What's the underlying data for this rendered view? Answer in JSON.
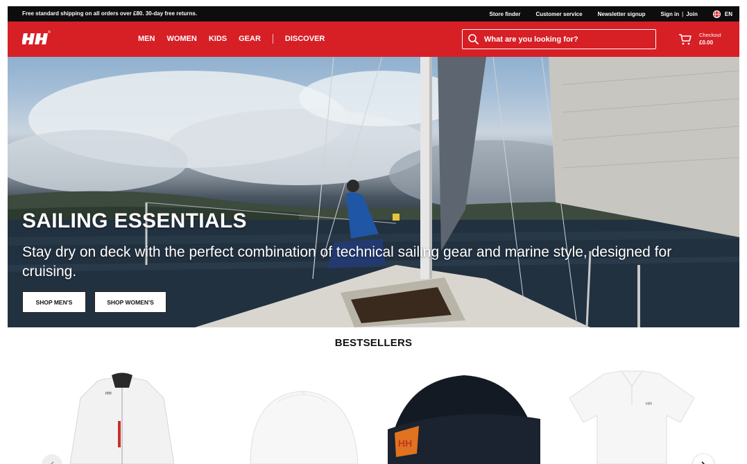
{
  "utility_bar": {
    "promo": "Free standard shipping on all orders over £80. 30-day free returns.",
    "store_finder": "Store finder",
    "customer_service": "Customer service",
    "newsletter": "Newsletter signup",
    "sign_in": "Sign in",
    "separator": "|",
    "join": "Join",
    "language": "EN"
  },
  "header": {
    "logo_text": "HH",
    "logo_sup": "®",
    "nav": [
      "MEN",
      "WOMEN",
      "KIDS",
      "GEAR",
      "DISCOVER"
    ],
    "search_placeholder": "What are you looking for?",
    "checkout_label": "Checkout",
    "checkout_total": "£0.00",
    "brand_red": "#d71f26"
  },
  "hero": {
    "title": "SAILING ESSENTIALS",
    "subtitle": "Stay dry on deck with the perfect combination of technical sailing gear and marine style, designed for cruising.",
    "button_men": "SHOP MEN'S",
    "button_women": "SHOP WOMEN'S"
  },
  "bestsellers": {
    "title": "BESTSELLERS",
    "products": [
      {
        "name": "white-sailing-jacket",
        "icon": "jacket-image"
      },
      {
        "name": "white-cap",
        "icon": "cap-image"
      },
      {
        "name": "navy-beanie",
        "icon": "beanie-image"
      },
      {
        "name": "white-polo-shirt",
        "icon": "polo-image"
      }
    ]
  }
}
